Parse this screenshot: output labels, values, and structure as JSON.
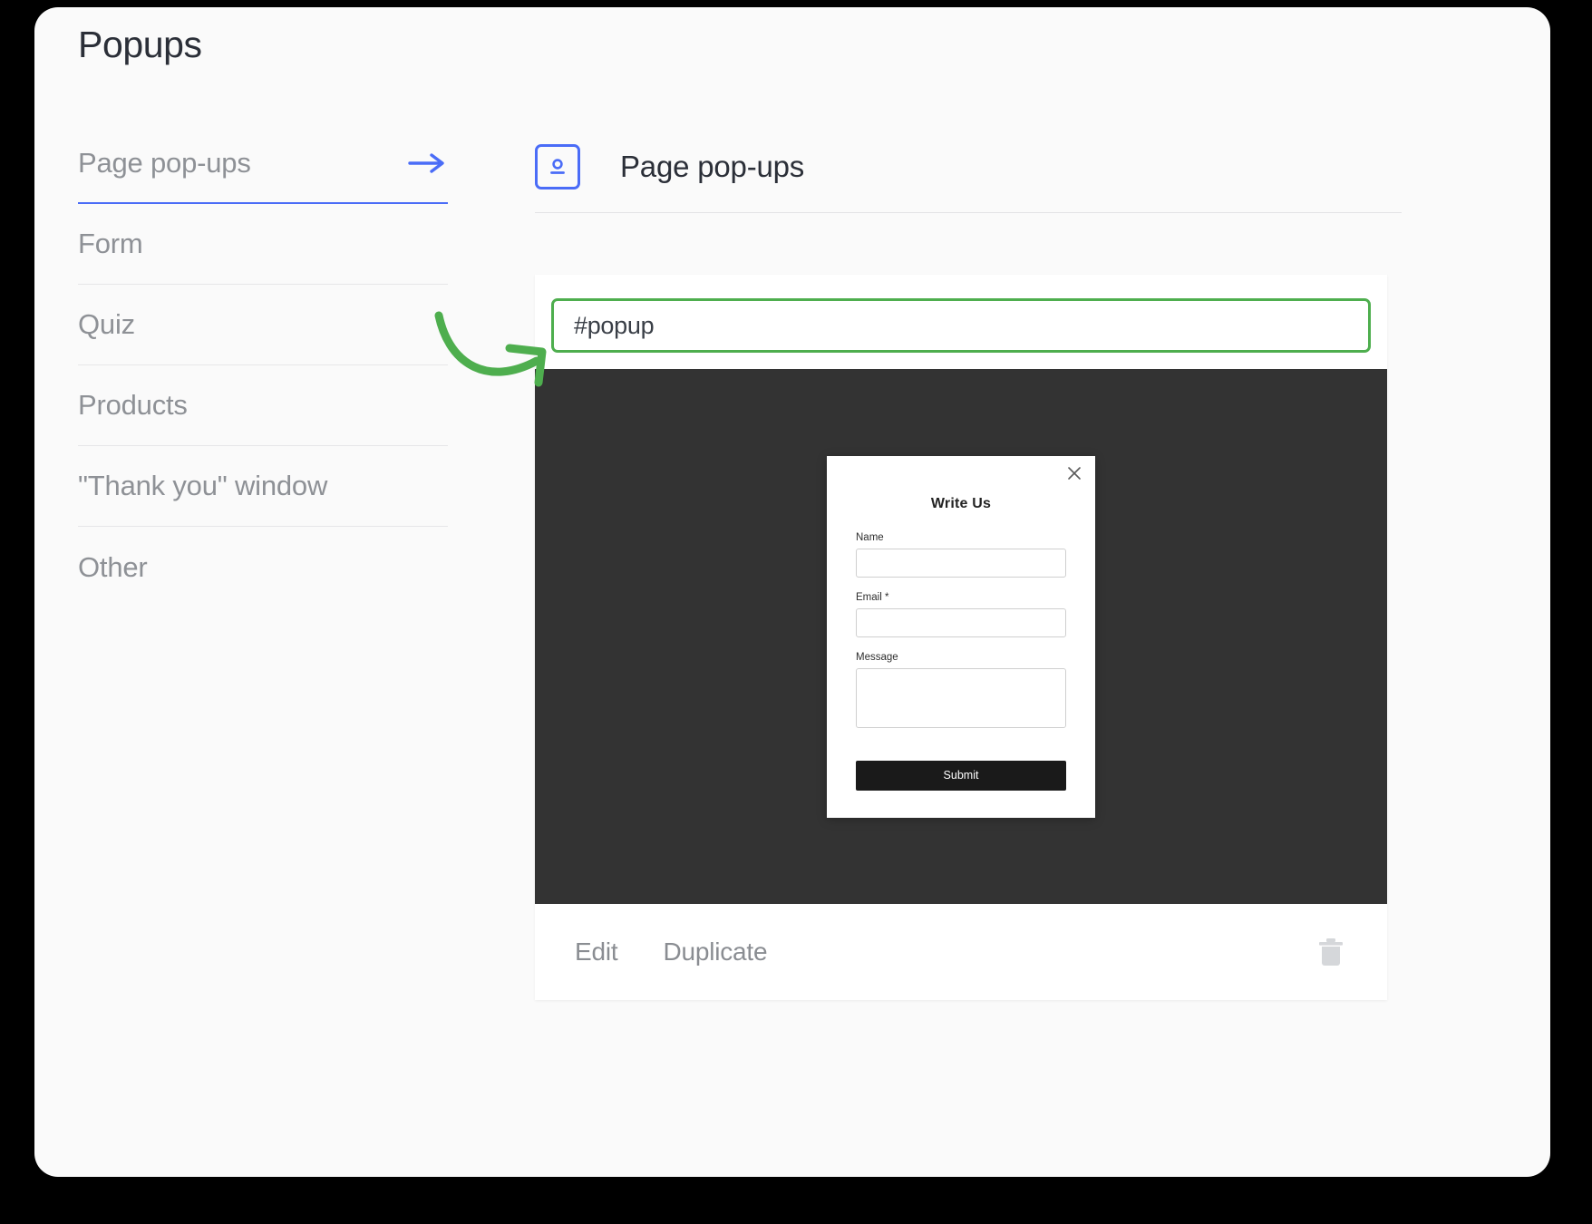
{
  "window": {
    "page_title": "Popups"
  },
  "sidebar": {
    "items": [
      {
        "label": "Page pop-ups",
        "active": true,
        "icon": "arrow-right-icon"
      },
      {
        "label": "Form",
        "active": false
      },
      {
        "label": "Quiz",
        "active": false
      },
      {
        "label": "Products",
        "active": false
      },
      {
        "label": "\"Thank you\" window",
        "active": false
      },
      {
        "label": "Other",
        "active": false
      }
    ]
  },
  "panel": {
    "icon_name": "page-popup-icon",
    "title": "Page pop-ups"
  },
  "popup_editor": {
    "anchor": {
      "value": "#popup",
      "placeholder": "#popup"
    },
    "preview": {
      "close_icon": "close-icon",
      "heading": "Write Us",
      "fields": [
        {
          "label": "Name",
          "type": "text",
          "value": ""
        },
        {
          "label": "Email *",
          "type": "text",
          "value": ""
        },
        {
          "label": "Message",
          "type": "textarea",
          "value": ""
        }
      ],
      "submit_label": "Submit"
    },
    "footer": {
      "actions": [
        {
          "label": "Edit"
        },
        {
          "label": "Duplicate"
        }
      ],
      "delete_icon": "trash-icon"
    }
  },
  "annotation": {
    "type": "curved-arrow",
    "color": "#4eae4e"
  },
  "colors": {
    "accent_blue": "#4a6cf7",
    "accent_green": "#4eae4e",
    "stage_dark": "#333333",
    "text_dark": "#2b2f38",
    "text_muted": "#8e9196",
    "submit_black": "#1a1a1a",
    "trash_gray": "#d5d7da"
  }
}
